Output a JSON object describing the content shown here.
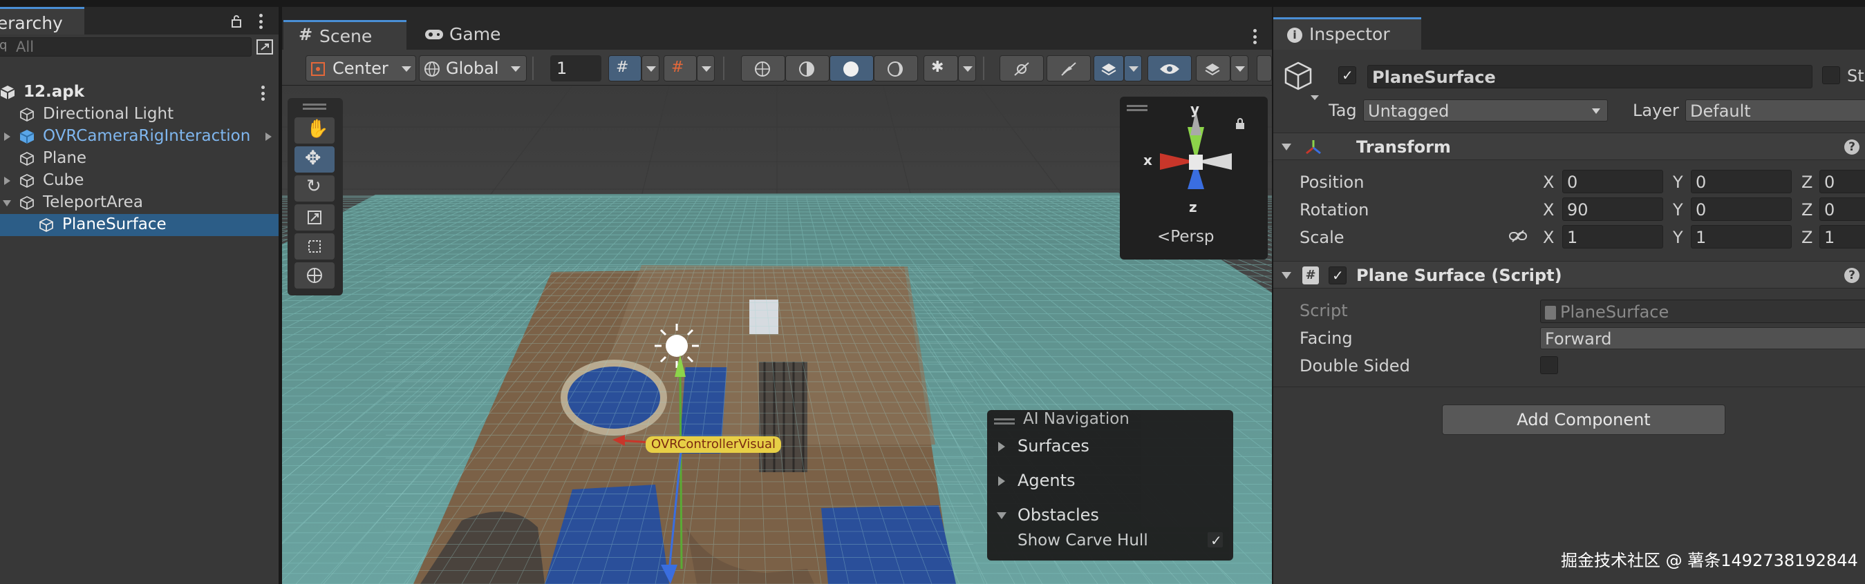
{
  "hierarchy": {
    "tab_label": "Hierarchy",
    "search_placeholder": "All",
    "root": "12.apk",
    "items": [
      {
        "label": "Directional Light"
      },
      {
        "label": "OVRCameraRigInteraction"
      },
      {
        "label": "Plane"
      },
      {
        "label": "Cube"
      },
      {
        "label": "TeleportArea"
      },
      {
        "label": "PlaneSurface"
      }
    ]
  },
  "scene": {
    "tabs": [
      {
        "label": "Scene"
      },
      {
        "label": "Game"
      }
    ],
    "toolbar": {
      "pivot": "Center",
      "space": "Global",
      "grid_value": "1"
    },
    "gizmo": {
      "y": "y",
      "x": "x",
      "z": "z",
      "persp": "Persp"
    },
    "object_label": "OVRControllerVisual",
    "ai_navigation": {
      "title": "AI Navigation",
      "items": [
        {
          "label": "Surfaces"
        },
        {
          "label": "Agents"
        },
        {
          "label": "Obstacles"
        }
      ],
      "show_carve_hull": "Show Carve Hull"
    }
  },
  "inspector": {
    "tab_label": "Inspector",
    "object_name": "PlaneSurface",
    "static_label": "Static",
    "tag_label": "Tag",
    "tag_value": "Untagged",
    "layer_label": "Layer",
    "layer_value": "Default",
    "transform": {
      "title": "Transform",
      "position": {
        "label": "Position",
        "x": "0",
        "y": "0",
        "z": "0"
      },
      "rotation": {
        "label": "Rotation",
        "x": "90",
        "y": "0",
        "z": "0"
      },
      "scale": {
        "label": "Scale",
        "x": "1",
        "y": "1",
        "z": "1"
      }
    },
    "plane_surface": {
      "title": "Plane Surface (Script)",
      "script_label": "Script",
      "script_value": "PlaneSurface",
      "facing_label": "Facing",
      "facing_value": "Forward",
      "double_sided_label": "Double Sided"
    },
    "add_component": "Add Component"
  },
  "watermark": "掘金技术社区 @ 薯条1492738192844",
  "colors": {
    "selection": "#2c5d87",
    "accent": "#4a8fd6",
    "prefab_text": "#7fb6ee"
  }
}
